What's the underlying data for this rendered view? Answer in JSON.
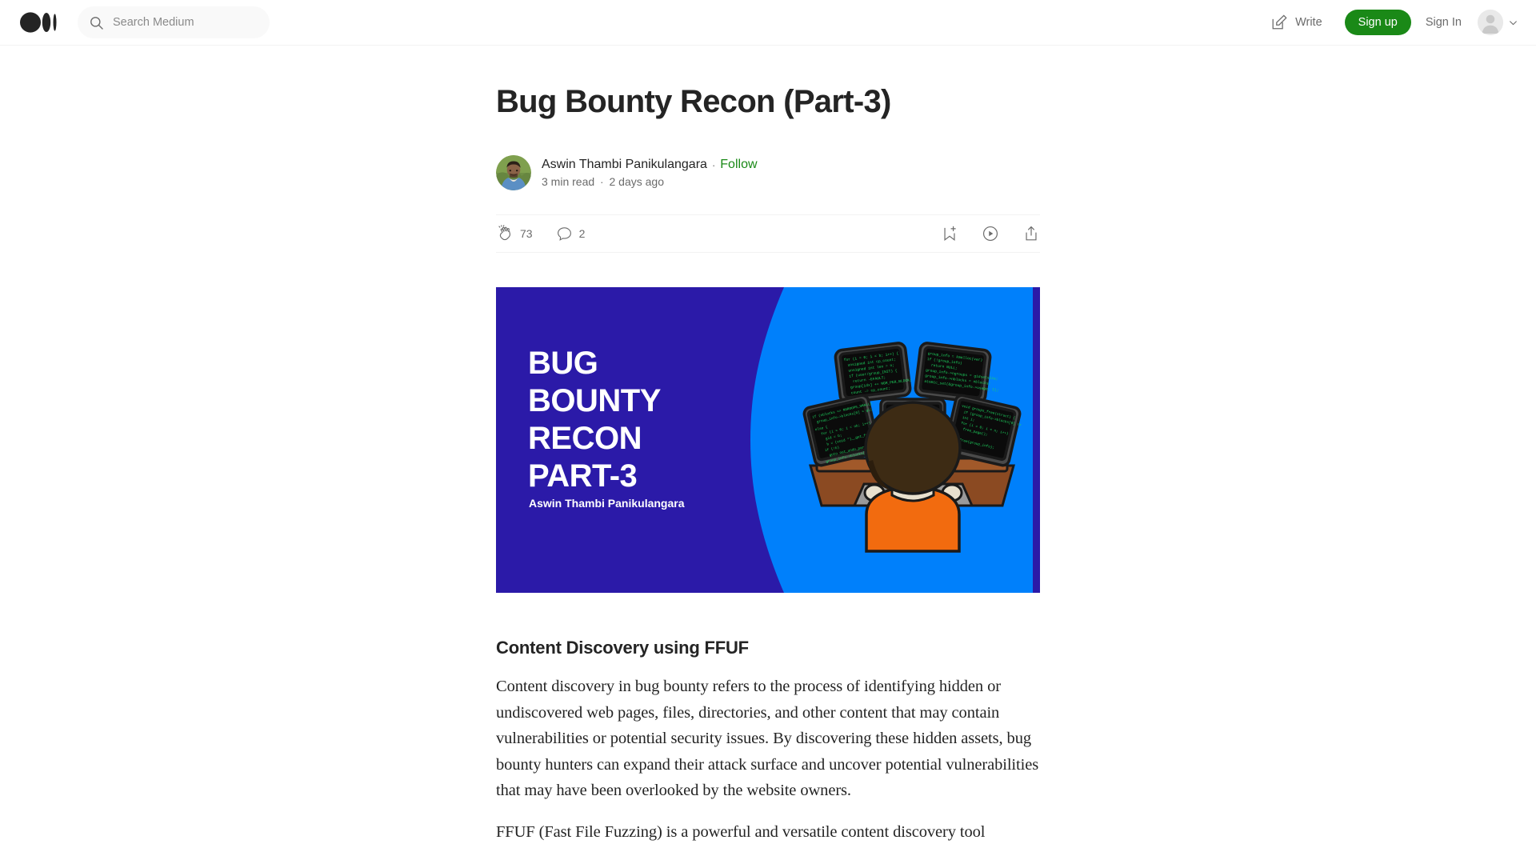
{
  "header": {
    "logo_name": "medium-logo",
    "search": {
      "placeholder": "Search Medium",
      "value": "",
      "icon": "search-icon"
    },
    "write_label": "Write",
    "write_icon": "pencil-square-icon",
    "signup_label": "Sign up",
    "signin_label": "Sign In",
    "avatar_icon": "user-avatar-placeholder",
    "chevron_icon": "chevron-down-icon"
  },
  "article": {
    "title": "Bug Bounty Recon (Part-3)",
    "author": {
      "name": "Aswin Thambi Panikulangara",
      "avatar_name": "author-avatar",
      "follow_label": "Follow",
      "separator": "·"
    },
    "meta": {
      "read_time": "3 min read",
      "separator": "·",
      "published": "2 days ago"
    },
    "engagement": {
      "clap_icon": "clap-icon",
      "clap_count": "73",
      "comment_icon": "comment-bubble-icon",
      "comment_count": "2",
      "bookmark_icon": "bookmark-plus-icon",
      "listen_icon": "play-circle-icon",
      "share_icon": "share-upload-icon"
    },
    "hero_image": {
      "name": "article-hero-image",
      "bg_left_color": "#2B1AA8",
      "bg_right_color": "#0080FB",
      "title_line1": "BUG",
      "title_line2": "BOUNTY",
      "title_line3": "RECON",
      "title_line4": "PART-3",
      "byline": "Aswin Thambi Panikulangara",
      "illustration": "hacker-at-multi-monitor-desk",
      "shirt_color": "#F26B0F",
      "hair_color": "#3D2B14",
      "desk_color": "#8B4A22",
      "screen_color": "#0B0B0B",
      "code_color": "#1ED760"
    },
    "body": [
      {
        "type": "heading",
        "text": "Content Discovery using FFUF"
      },
      {
        "type": "paragraph",
        "text": "Content discovery in bug bounty refers to the process of identifying hidden or undiscovered web pages, files, directories, and other content that may contain vulnerabilities or potential security issues. By discovering these hidden assets, bug bounty hunters can expand their attack surface and uncover potential vulnerabilities that may have been overlooked by the website owners."
      },
      {
        "type": "paragraph",
        "text": "FFUF (Fast File Fuzzing) is a powerful and versatile content discovery tool"
      }
    ]
  },
  "colors": {
    "brand_green": "#1A8917",
    "text_primary": "#242424",
    "text_secondary": "#6B6B6B",
    "border": "#F2F2F2",
    "search_bg": "#F9F9F9"
  }
}
